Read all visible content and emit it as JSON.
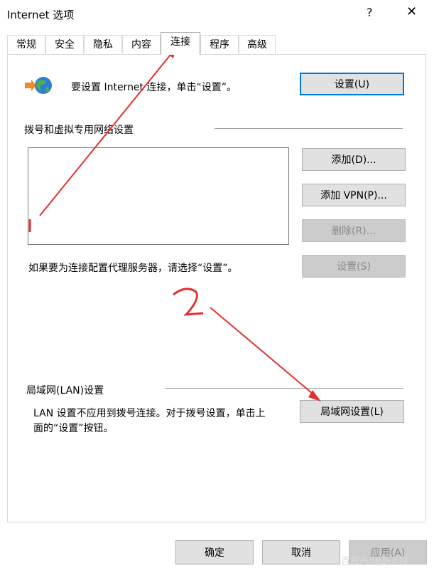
{
  "window": {
    "title": "Internet 选项",
    "help_label": "?",
    "close_label": "✕"
  },
  "tabs": [
    {
      "label": "常规",
      "active": false
    },
    {
      "label": "安全",
      "active": false
    },
    {
      "label": "隐私",
      "active": false
    },
    {
      "label": "内容",
      "active": false
    },
    {
      "label": "连接",
      "active": true
    },
    {
      "label": "程序",
      "active": false
    },
    {
      "label": "高级",
      "active": false
    }
  ],
  "setup": {
    "text": "要设置 Internet 连接，单击“设置”。",
    "button": "设置(U)"
  },
  "dialup": {
    "section_label": "拨号和虚拟专用网络设置",
    "add_button": "添加(D)...",
    "add_vpn_button": "添加 VPN(P)...",
    "remove_button": "删除(R)...",
    "settings_button": "设置(S)",
    "proxy_text": "如果要为连接配置代理服务器，请选择“设置”。"
  },
  "lan": {
    "section_label": "局域网(LAN)设置",
    "description_line1": "LAN 设置不应用到拨号连接。对于拨号设置，单击上",
    "description_line2": "面的“设置”按钮。",
    "button": "局域网设置(L)"
  },
  "footer": {
    "ok": "确定",
    "cancel": "取消",
    "apply": "应用(A)"
  },
  "watermark": "百家号/国哥互联",
  "colors": {
    "annotation": "#e03030",
    "focus": "#0078d7"
  }
}
